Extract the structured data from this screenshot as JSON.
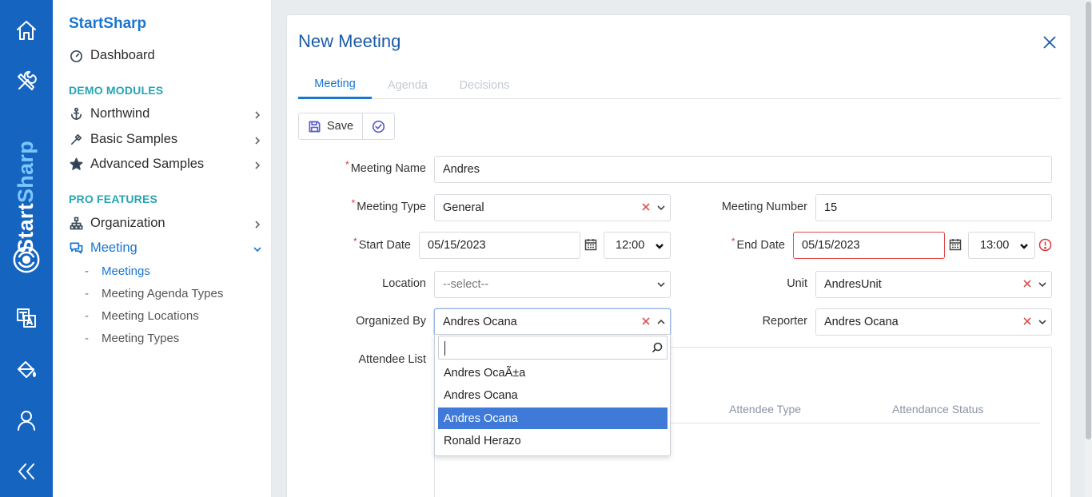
{
  "brand": {
    "vertical_part1": "Start",
    "vertical_part2": "Sharp"
  },
  "rail": {
    "icons": [
      "home-icon",
      "tools-icon",
      "logo-swirl-icon",
      "translate-icon",
      "paint-bucket-icon",
      "user-icon",
      "collapse-double-chevron-icon"
    ]
  },
  "sidebar": {
    "title": "StartSharp",
    "dashboard": "Dashboard",
    "section_demo": "DEMO MODULES",
    "northwind": "Northwind",
    "basic_samples": "Basic Samples",
    "advanced_samples": "Advanced Samples",
    "section_pro": "PRO FEATURES",
    "organization": "Organization",
    "meeting": "Meeting",
    "meeting_children": [
      "Meetings",
      "Meeting Agenda Types",
      "Meeting Locations",
      "Meeting Types"
    ]
  },
  "dialog": {
    "title": "New Meeting",
    "tabs": [
      "Meeting",
      "Agenda",
      "Decisions"
    ],
    "toolbar": {
      "save_label": "Save"
    },
    "form": {
      "meeting_name_label": "Meeting Name",
      "meeting_name_value": "Andres",
      "meeting_type_label": "Meeting Type",
      "meeting_type_value": "General",
      "meeting_number_label": "Meeting Number",
      "meeting_number_value": "15",
      "start_date_label": "Start Date",
      "start_date_value": "05/15/2023",
      "start_time_value": "12:00",
      "end_date_label": "End Date",
      "end_date_value": "05/15/2023",
      "end_time_value": "13:00",
      "location_label": "Location",
      "location_placeholder": "--select--",
      "unit_label": "Unit",
      "unit_value": "AndresUnit",
      "organized_by_label": "Organized By",
      "organized_by_value": "Andres Ocana",
      "reporter_label": "Reporter",
      "reporter_value": "Andres Ocana",
      "attendee_list_label": "Attendee List",
      "attendee_columns": [
        "Attendee Type",
        "Attendance Status"
      ]
    },
    "dropdown": {
      "search_value": "",
      "options": [
        "Andres OcaÃ±a",
        "Andres Ocana",
        "Andres Ocana",
        "Ronald Herazo"
      ],
      "selected_index": 2
    }
  },
  "colors": {
    "rail": "#1565c0",
    "accent": "#1976d2",
    "section": "#26a4b5",
    "error": "#d9363e",
    "selected": "#3f7ad8"
  }
}
